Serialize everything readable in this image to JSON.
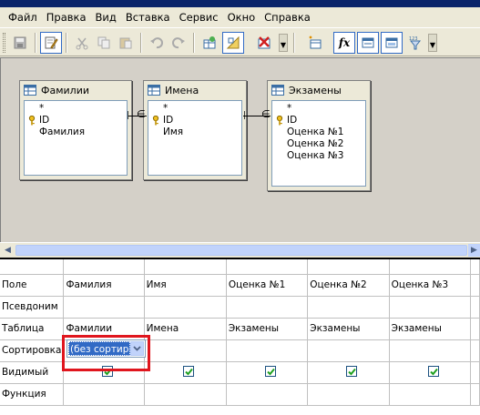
{
  "menu": [
    "Файл",
    "Правка",
    "Вид",
    "Вставка",
    "Сервис",
    "Окно",
    "Справка"
  ],
  "toolbar": {
    "buttons": [
      "save-icon",
      "edit-mode-icon",
      "cut-icon",
      "copy-icon",
      "paste-icon",
      "undo-icon",
      "redo-icon",
      "add-table-icon",
      "design-icon",
      "delete-icon",
      "new-field-icon",
      "function-icon",
      "table-name-icon",
      "alias-icon",
      "distinct-icon"
    ],
    "function_glyph": "fx"
  },
  "tables": [
    {
      "title": "Фамилии",
      "fields": [
        "*",
        "ID",
        "Фамилия"
      ]
    },
    {
      "title": "Имена",
      "fields": [
        "*",
        "ID",
        "Имя"
      ]
    },
    {
      "title": "Экзамены",
      "fields": [
        "*",
        "ID",
        "Оценка №1",
        "Оценка №2",
        "Оценка №3"
      ]
    }
  ],
  "grid": {
    "row_labels": [
      "Поле",
      "Псевдоним",
      "Таблица",
      "Сортировка",
      "Видимый",
      "Функция"
    ],
    "columns": [
      {
        "field": "Фамилия",
        "table": "Фамилии",
        "visible": true
      },
      {
        "field": "Имя",
        "table": "Имена",
        "visible": true
      },
      {
        "field": "Оценка №1",
        "table": "Экзамены",
        "visible": true
      },
      {
        "field": "Оценка №2",
        "table": "Экзамены",
        "visible": true
      },
      {
        "field": "Оценка №3",
        "table": "Экзамены",
        "visible": true
      }
    ],
    "sort_value": "(без сортиров"
  },
  "colors": {
    "highlight": "#E0161E",
    "selection": "#316AC5"
  }
}
